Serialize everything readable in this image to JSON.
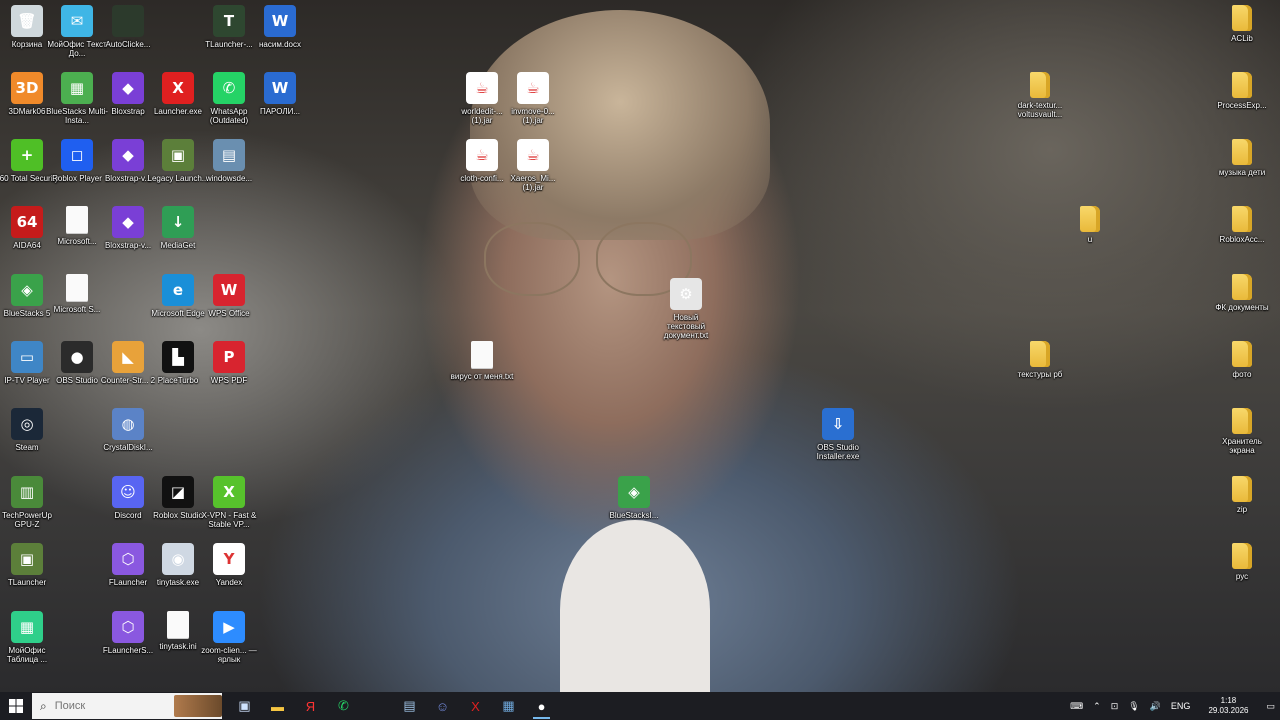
{
  "desktop_icons": [
    {
      "name": "recycle-bin",
      "label": "Корзина",
      "glyph": "🗑",
      "bg": "#cfd8dc"
    },
    {
      "name": "myoffice-text",
      "label": "МойОфис Текст До...",
      "glyph": "✉",
      "bg": "#3fb6e6"
    },
    {
      "name": "autoclicker",
      "label": "AutoClicke...",
      "glyph": "",
      "bg": "#2c3a2c"
    },
    {
      "name": "tlauncher-1",
      "label": "TLauncher-...",
      "glyph": "T",
      "bg": "#2e4730"
    },
    {
      "name": "word-doc-nasim",
      "label": "насим.docx",
      "glyph": "W",
      "bg": "#2a6bd1"
    },
    {
      "name": "3dmark06",
      "label": "3DMark06",
      "glyph": "3D",
      "bg": "#f08a2a"
    },
    {
      "name": "bluestacks-multi",
      "label": "BlueStacks Multi-Insta...",
      "glyph": "▦",
      "bg": "#4caf50"
    },
    {
      "name": "bloxstrap",
      "label": "Bloxstrap",
      "glyph": "◆",
      "bg": "#7a3fd6"
    },
    {
      "name": "launcher-exe",
      "label": "Launcher.exe",
      "glyph": "X",
      "bg": "#e02020"
    },
    {
      "name": "whatsapp",
      "label": "WhatsApp (Outdated)",
      "glyph": "✆",
      "bg": "#25d366"
    },
    {
      "name": "paroli-doc",
      "label": "ПАРОЛИ...",
      "glyph": "W",
      "bg": "#2a6bd1"
    },
    {
      "name": "360-total-security",
      "label": "360 Total Security",
      "glyph": "+",
      "bg": "#4fbf26"
    },
    {
      "name": "roblox-player",
      "label": "Roblox Player",
      "glyph": "◻",
      "bg": "#1f5ff0"
    },
    {
      "name": "bloxstrap-2",
      "label": "Bloxstrap-v...",
      "glyph": "◆",
      "bg": "#7a3fd6"
    },
    {
      "name": "legacy-launcher",
      "label": "Legacy Launch...",
      "glyph": "▣",
      "bg": "#5c7f3a"
    },
    {
      "name": "windowsde",
      "label": "windowsde...",
      "glyph": "▤",
      "bg": "#6a8fb0"
    },
    {
      "name": "aida64",
      "label": "AIDA64",
      "glyph": "64",
      "bg": "#c51b1b"
    },
    {
      "name": "microsoft-doc-1",
      "label": "Microsoft...",
      "glyph": "",
      "bg": "#ffffff"
    },
    {
      "name": "bloxstrap-3",
      "label": "Bloxstrap-v...",
      "glyph": "◆",
      "bg": "#7a3fd6"
    },
    {
      "name": "mediaget",
      "label": "MediaGet",
      "glyph": "↓",
      "bg": "#2f9e55"
    },
    {
      "name": "bluestacks5",
      "label": "BlueStacks 5",
      "glyph": "◈",
      "bg": "#3aa24a"
    },
    {
      "name": "microsoft-doc-2",
      "label": "Microsoft S...",
      "glyph": "",
      "bg": "#ffffff"
    },
    {
      "name": "microsoft-edge",
      "label": "Microsoft Edge",
      "glyph": "e",
      "bg": "#1a8fd8"
    },
    {
      "name": "wps-office",
      "label": "WPS Office",
      "glyph": "W",
      "bg": "#d8242f"
    },
    {
      "name": "iptv-player",
      "label": "IP-TV Player",
      "glyph": "▭",
      "bg": "#3f86c6"
    },
    {
      "name": "obs-studio",
      "label": "OBS Studio",
      "glyph": "●",
      "bg": "#2b2b2b"
    },
    {
      "name": "counter-strike",
      "label": "Counter-Str... 2",
      "glyph": "◣",
      "bg": "#e8a23a"
    },
    {
      "name": "placeturbo",
      "label": "PlaceTurbo",
      "glyph": "▙",
      "bg": "#111111"
    },
    {
      "name": "wps-pdf",
      "label": "WPS PDF",
      "glyph": "P",
      "bg": "#d8242f"
    },
    {
      "name": "steam",
      "label": "Steam",
      "glyph": "◎",
      "bg": "#1b2838"
    },
    {
      "name": "crystaldisk",
      "label": "CrystalDiskI...",
      "glyph": "◍",
      "bg": "#5b83c7"
    },
    {
      "name": "techpowerup-gpuz",
      "label": "TechPowerUp GPU-Z",
      "glyph": "▥",
      "bg": "#4a8a3a"
    },
    {
      "name": "discord",
      "label": "Discord",
      "glyph": "☺",
      "bg": "#5865f2"
    },
    {
      "name": "roblox-studio",
      "label": "Roblox Studio",
      "glyph": "◪",
      "bg": "#111111"
    },
    {
      "name": "xvpn",
      "label": "X-VPN - Fast & Stable VP...",
      "glyph": "X",
      "bg": "#57c22c"
    },
    {
      "name": "tlauncher-2",
      "label": "TLauncher",
      "glyph": "▣",
      "bg": "#5c7f3a"
    },
    {
      "name": "flauncher",
      "label": "FLauncher",
      "glyph": "⬡",
      "bg": "#8a58e0"
    },
    {
      "name": "tinytask-exe",
      "label": "tinytask.exe",
      "glyph": "◉",
      "bg": "#cfd8e3"
    },
    {
      "name": "yandex",
      "label": "Yandex",
      "glyph": "Y",
      "bg": "#ffffff"
    },
    {
      "name": "myoffice-table",
      "label": "МойОфис Таблица ...",
      "glyph": "▦",
      "bg": "#2fcf8a"
    },
    {
      "name": "flaunchers",
      "label": "FLauncherS...",
      "glyph": "⬡",
      "bg": "#8a58e0"
    },
    {
      "name": "tinytask-ini",
      "label": "tinytask.ini",
      "glyph": "",
      "bg": "#ffffff"
    },
    {
      "name": "zoom",
      "label": "zoom-clien... — ярлык",
      "glyph": "▶",
      "bg": "#2d8cff"
    },
    {
      "name": "worldedit-jar",
      "label": "worldedit-... (1).jar",
      "glyph": "☕",
      "bg": "#ffffff"
    },
    {
      "name": "invmove-jar",
      "label": "invmove-0... (1).jar",
      "glyph": "☕",
      "bg": "#ffffff"
    },
    {
      "name": "cloth-config-jar",
      "label": "cloth-confi...",
      "glyph": "☕",
      "bg": "#ffffff"
    },
    {
      "name": "xaeros-jar",
      "label": "Xaeros_Mi... (1).jar",
      "glyph": "☕",
      "bg": "#ffffff"
    },
    {
      "name": "new-text-doc",
      "label": "Новый текстовый документ.txt",
      "glyph": "⚙",
      "bg": "#e6e6e6"
    },
    {
      "name": "virus-txt",
      "label": "вирус от меня.txt",
      "glyph": "",
      "bg": "#ffffff"
    },
    {
      "name": "obs-installer",
      "label": "OBS Studio Installer.exe",
      "glyph": "⇩",
      "bg": "#2a6fd1"
    },
    {
      "name": "bluestacks-shortcut",
      "label": "BlueStacksI...",
      "glyph": "◈",
      "bg": "#3aa24a"
    },
    {
      "name": "dark-textur-zip",
      "label": "dark-textur... voltusvault...",
      "glyph": "",
      "bg": "folder"
    },
    {
      "name": "folder-u",
      "label": "u",
      "glyph": "",
      "bg": "folder"
    },
    {
      "name": "folder-textures",
      "label": "текстуры рб",
      "glyph": "",
      "bg": "folder"
    },
    {
      "name": "folder-aclib",
      "label": "ACLib",
      "glyph": "",
      "bg": "folder"
    },
    {
      "name": "folder-processexp",
      "label": "ProcessExp...",
      "glyph": "",
      "bg": "folder"
    },
    {
      "name": "folder-music",
      "label": "музыка дети",
      "glyph": "",
      "bg": "folder"
    },
    {
      "name": "folder-robloxacc",
      "label": "RobloxAcc...",
      "glyph": "",
      "bg": "folder"
    },
    {
      "name": "folder-fk-docs",
      "label": "ФК документы",
      "glyph": "",
      "bg": "folder"
    },
    {
      "name": "folder-photo",
      "label": "фото",
      "glyph": "",
      "bg": "folder"
    },
    {
      "name": "folder-screensaver",
      "label": "Хранитель экрана",
      "glyph": "",
      "bg": "folder"
    },
    {
      "name": "folder-zip",
      "label": "zip",
      "glyph": "",
      "bg": "folder"
    },
    {
      "name": "folder-rus",
      "label": "рус",
      "glyph": "",
      "bg": "folder"
    }
  ],
  "taskbar": {
    "search_placeholder": "Поиск",
    "apps": [
      {
        "name": "task-view",
        "glyph": "▣",
        "color": "#cfe3ff",
        "active": false
      },
      {
        "name": "file-explorer",
        "glyph": "▬",
        "color": "#f5c542",
        "active": false
      },
      {
        "name": "yandex-browser",
        "glyph": "Я",
        "color": "#ff3333",
        "active": false
      },
      {
        "name": "whatsapp",
        "glyph": "✆",
        "color": "#25d366",
        "active": false
      },
      {
        "name": "blank",
        "glyph": "",
        "color": "#888888",
        "active": false
      },
      {
        "name": "windowsde",
        "glyph": "▤",
        "color": "#9fc3e6",
        "active": false
      },
      {
        "name": "discord",
        "glyph": "☺",
        "color": "#7289da",
        "active": false
      },
      {
        "name": "launcher",
        "glyph": "X",
        "color": "#e02020",
        "active": false
      },
      {
        "name": "calculator",
        "glyph": "▦",
        "color": "#6fa8dc",
        "active": false
      },
      {
        "name": "obs",
        "glyph": "●",
        "color": "#ffffff",
        "active": true
      }
    ],
    "tray": {
      "language": "ENG",
      "time": "1:18",
      "date": "29.03.2026"
    }
  }
}
